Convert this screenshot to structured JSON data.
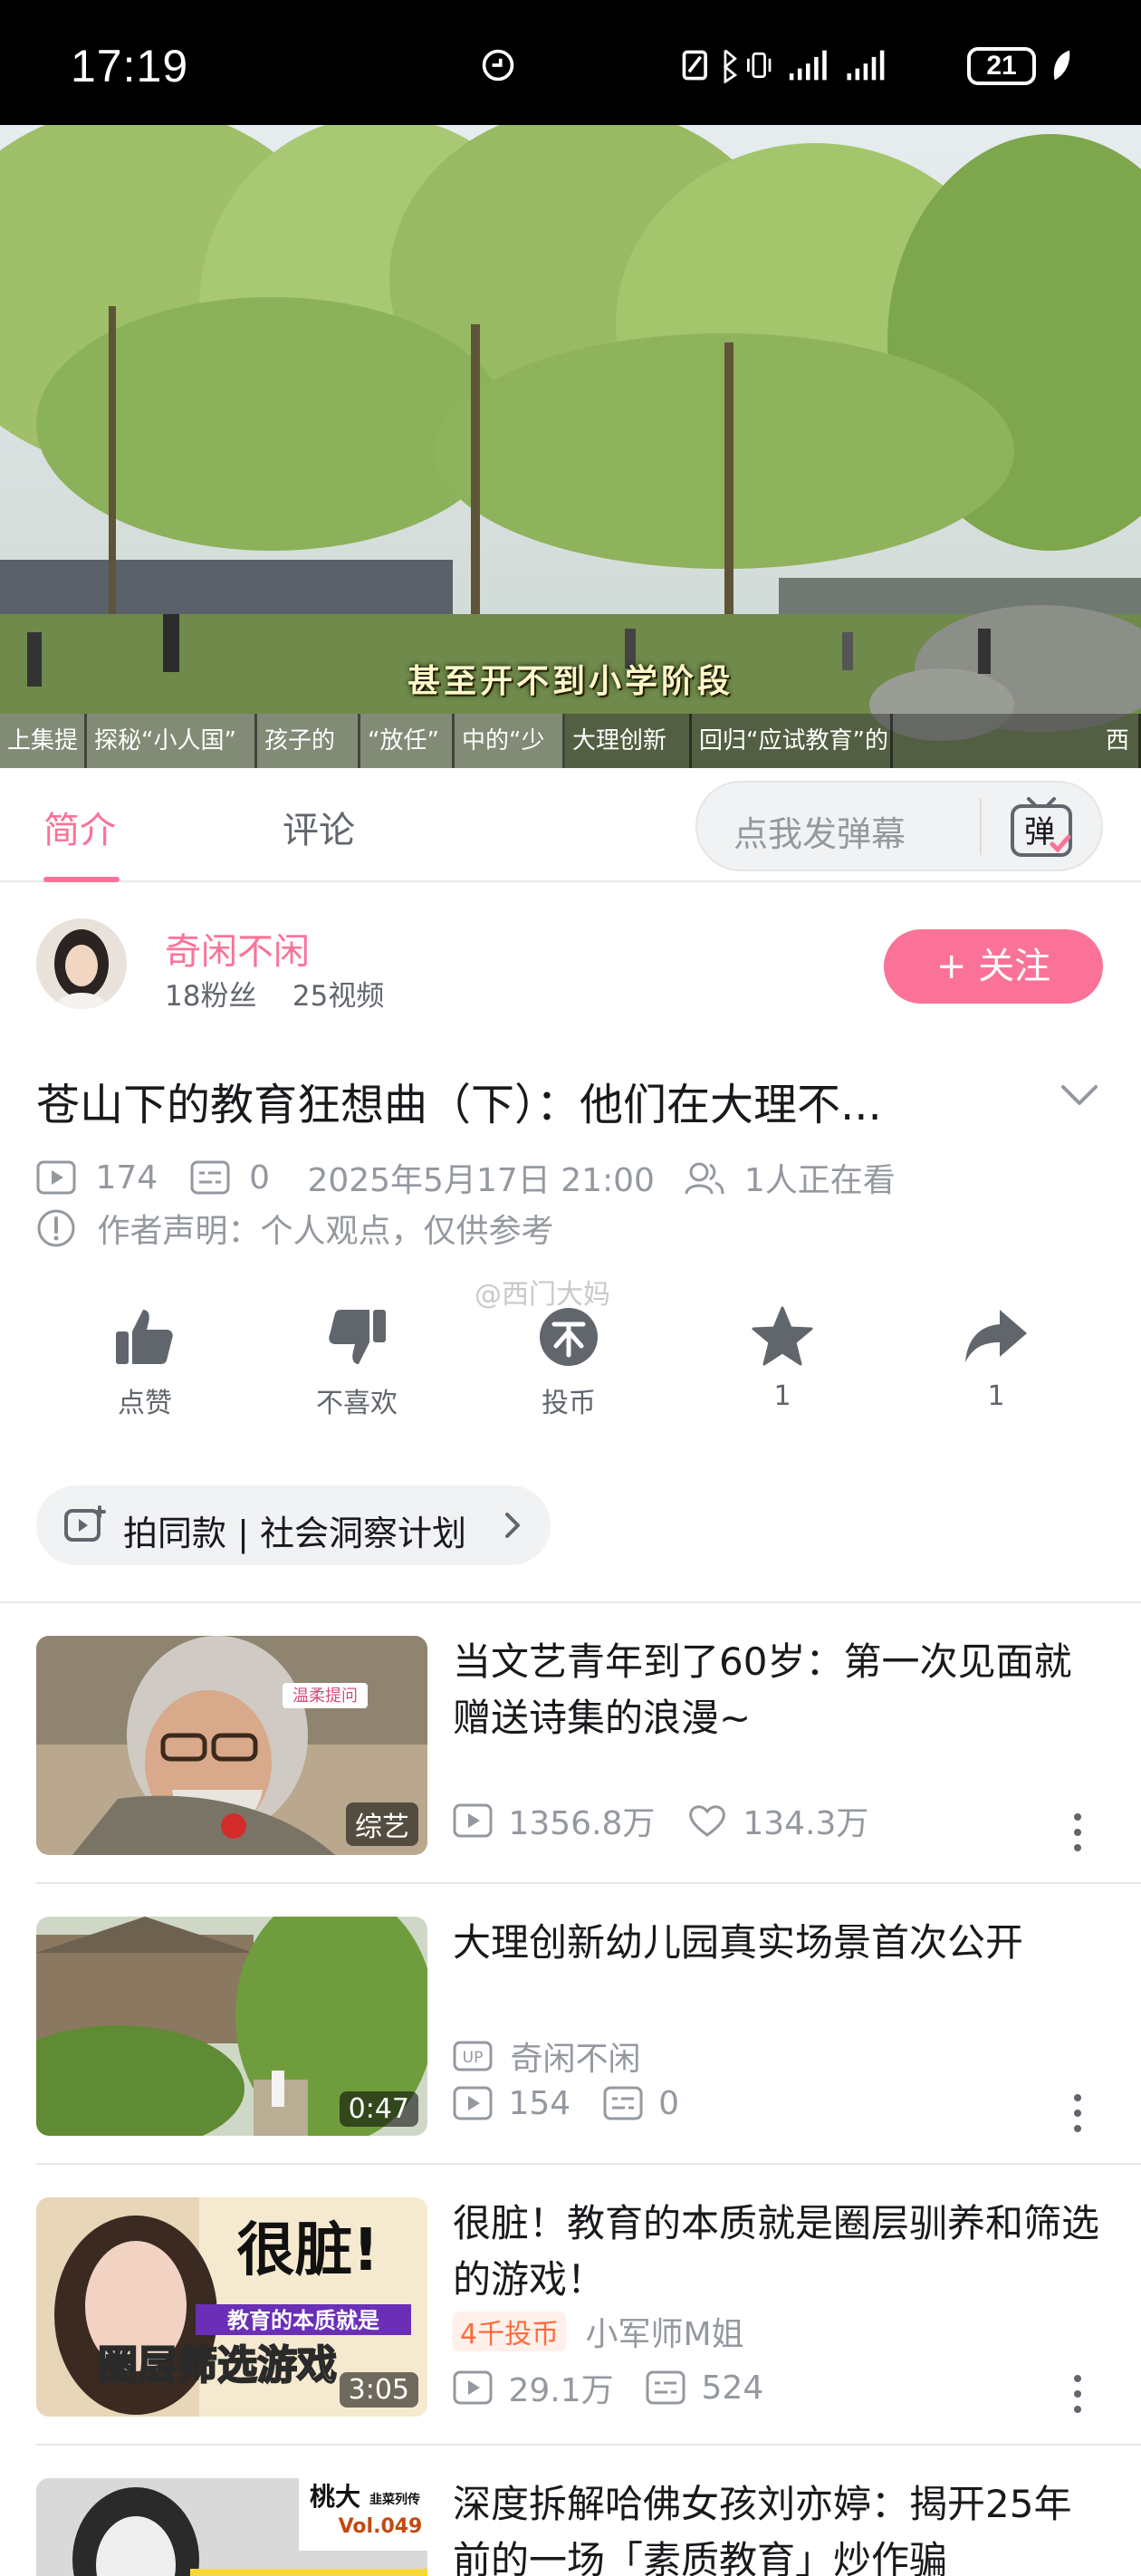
{
  "status_bar": {
    "time": "17:19",
    "battery": "21"
  },
  "video": {
    "subtitle": "甚至开不到小学阶段",
    "chapters": [
      "上集提",
      "探秘“小人国”",
      "孩子的",
      "“放任”",
      "中的“少",
      "大理创新",
      "回归“应试教育”的",
      "西"
    ]
  },
  "tabs": {
    "intro": "简介",
    "comments": "评论",
    "danmaku_placeholder": "点我发弹幕",
    "danmaku_icon_text": "弹"
  },
  "uploader": {
    "name": "奇闲不闲",
    "fans": "18粉丝",
    "videos": "25视频",
    "follow_label": "+ 关注"
  },
  "video_info": {
    "title": "苍山下的教育狂想曲（下）：他们在大理不...",
    "views": "174",
    "danmaku_count": "0",
    "date": "2025年5月17日 21:00",
    "watching": "1人正在看",
    "declaration": "作者声明：个人观点，仅供参考",
    "watermark": "@西门大妈"
  },
  "actions": [
    {
      "icon": "thumbs-up-icon",
      "label": "点赞"
    },
    {
      "icon": "thumbs-down-icon",
      "label": "不喜欢"
    },
    {
      "icon": "coin-icon",
      "label": "投币"
    },
    {
      "icon": "star-icon",
      "label": "1"
    },
    {
      "icon": "share-icon",
      "label": "1"
    }
  ],
  "chip": {
    "label": "拍同款 | 社会洞察计划"
  },
  "recommendations": [
    {
      "title": "当文艺青年到了60岁：第一次见面就赠送诗集的浪漫~",
      "badge": "综艺",
      "views": "1356.8万",
      "likes": "134.3万",
      "thumb_text": "温柔提问"
    },
    {
      "title": "大理创新幼儿园真实场景首次公开",
      "badge": "0:47",
      "author": "奇闲不闲",
      "views": "154",
      "danmaku": "0"
    },
    {
      "title": "很脏！教育的本质就是圈层驯养和筛选的游戏！",
      "badge": "3:05",
      "coin_tag": "4千投币",
      "author": "小军师M姐",
      "views": "29.1万",
      "danmaku": "524",
      "thumb_big": "很脏!",
      "thumb_small": "教育的本质就是",
      "thumb_bottom": "圈层筛选游戏"
    },
    {
      "title": "深度拆解哈佛女孩刘亦婷：揭开25年前的一场「素质教育」炒作骗",
      "thumb_brand": "桃大",
      "thumb_series": "韭菜列传",
      "thumb_vol": "Vol.049"
    }
  ],
  "colors": {
    "accent": "#fb7299",
    "secondary_text": "#9499a0",
    "coin_tag": "#ff6a3d"
  }
}
